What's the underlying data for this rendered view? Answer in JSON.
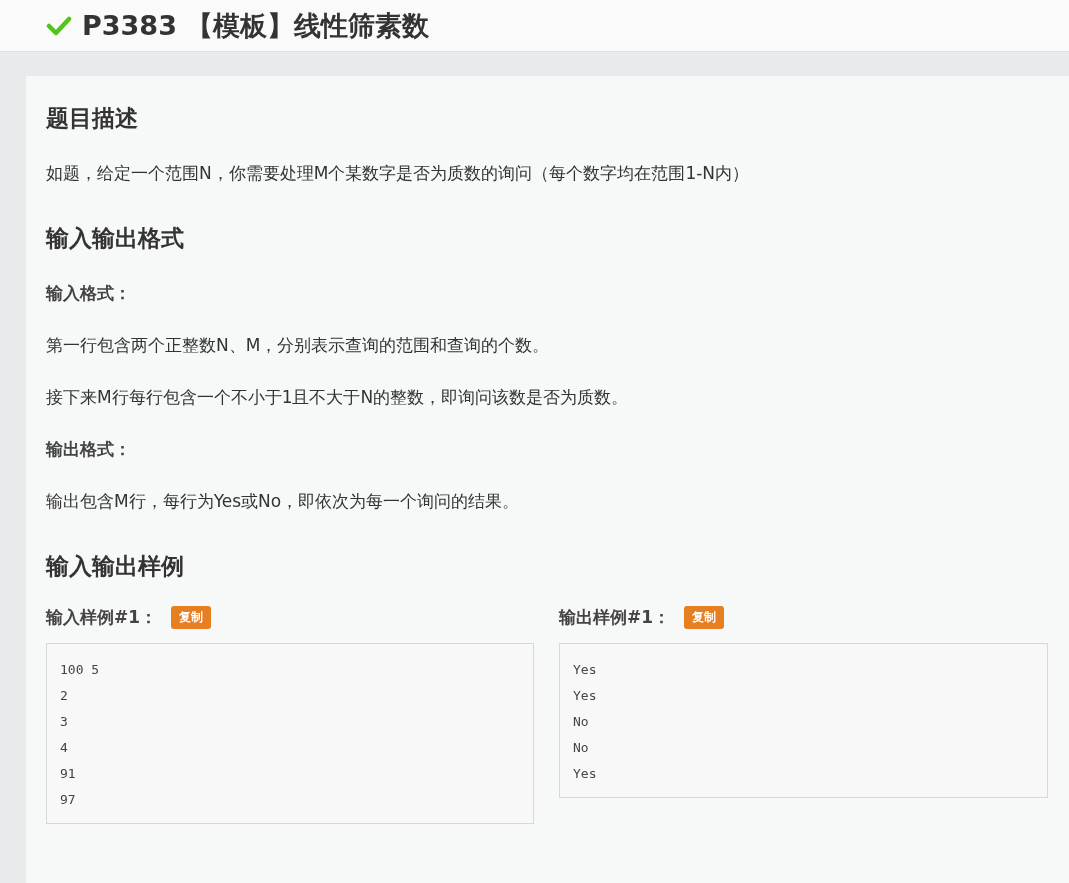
{
  "header": {
    "solved": true,
    "title": "P3383 【模板】线性筛素数"
  },
  "sections": [
    {
      "heading": "题目描述",
      "blocks": [
        {
          "kind": "paragraph",
          "text": "如题，给定一个范围N，你需要处理M个某数字是否为质数的询问（每个数字均在范围1-N内）"
        }
      ]
    },
    {
      "heading": "输入输出格式",
      "blocks": [
        {
          "kind": "subheading",
          "text": "输入格式："
        },
        {
          "kind": "paragraph",
          "text": "第一行包含两个正整数N、M，分别表示查询的范围和查询的个数。"
        },
        {
          "kind": "paragraph",
          "text": "接下来M行每行包含一个不小于1且不大于N的整数，即询问该数是否为质数。"
        },
        {
          "kind": "subheading",
          "text": "输出格式："
        },
        {
          "kind": "paragraph",
          "text": "输出包含M行，每行为Yes或No，即依次为每一个询问的结果。"
        }
      ]
    },
    {
      "heading": "输入输出样例",
      "samples": [
        {
          "label": "输入样例#1：",
          "button": "复制",
          "lines": [
            "100 5",
            "2",
            "3",
            "4",
            "91",
            "97"
          ]
        },
        {
          "label": "输出样例#1：",
          "button": "复制",
          "lines": [
            "Yes",
            "Yes",
            "No",
            "No",
            "Yes"
          ]
        }
      ]
    }
  ]
}
